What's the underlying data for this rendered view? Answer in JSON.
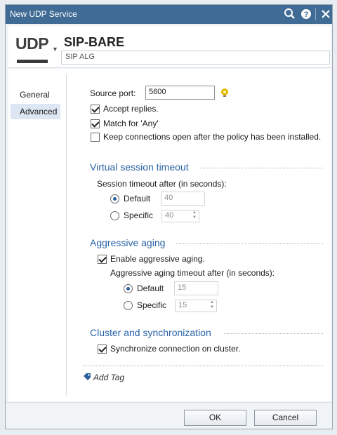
{
  "window": {
    "title": "New UDP Service",
    "icons": [
      "search-icon",
      "help-icon",
      "close-icon"
    ]
  },
  "header": {
    "logo_text": "UDP",
    "service_name": "SIP-BARE",
    "comment": "SIP ALG"
  },
  "nav": {
    "items": [
      {
        "label": "General",
        "active": false
      },
      {
        "label": "Advanced",
        "active": true
      }
    ]
  },
  "advanced": {
    "source_port_label": "Source port:",
    "source_port_value": "5600",
    "accept_replies": {
      "label": "Accept replies.",
      "checked": true
    },
    "match_any": {
      "label": "Match for 'Any'",
      "checked": true
    },
    "keep_open": {
      "label": "Keep connections open after the policy has been installed.",
      "checked": false
    },
    "virtual_session": {
      "title": "Virtual session timeout",
      "subtitle": "Session timeout after (in seconds):",
      "default_label": "Default",
      "default_value": "40",
      "specific_label": "Specific",
      "specific_value": "40",
      "selected": "default"
    },
    "aggressive_aging": {
      "title": "Aggressive aging",
      "enable": {
        "label": "Enable aggressive aging.",
        "checked": true
      },
      "subtitle": "Aggressive aging timeout after (in seconds):",
      "default_label": "Default",
      "default_value": "15",
      "specific_label": "Specific",
      "specific_value": "15",
      "selected": "default"
    },
    "cluster": {
      "title": "Cluster and synchronization",
      "sync": {
        "label": "Synchronize connection on cluster.",
        "checked": true
      }
    },
    "add_tag_label": "Add Tag"
  },
  "footer": {
    "ok_label": "OK",
    "cancel_label": "Cancel"
  },
  "colors": {
    "titlebar": "#3f6b94",
    "section_title": "#2a63a6",
    "nav_active": "#dde7f3"
  }
}
